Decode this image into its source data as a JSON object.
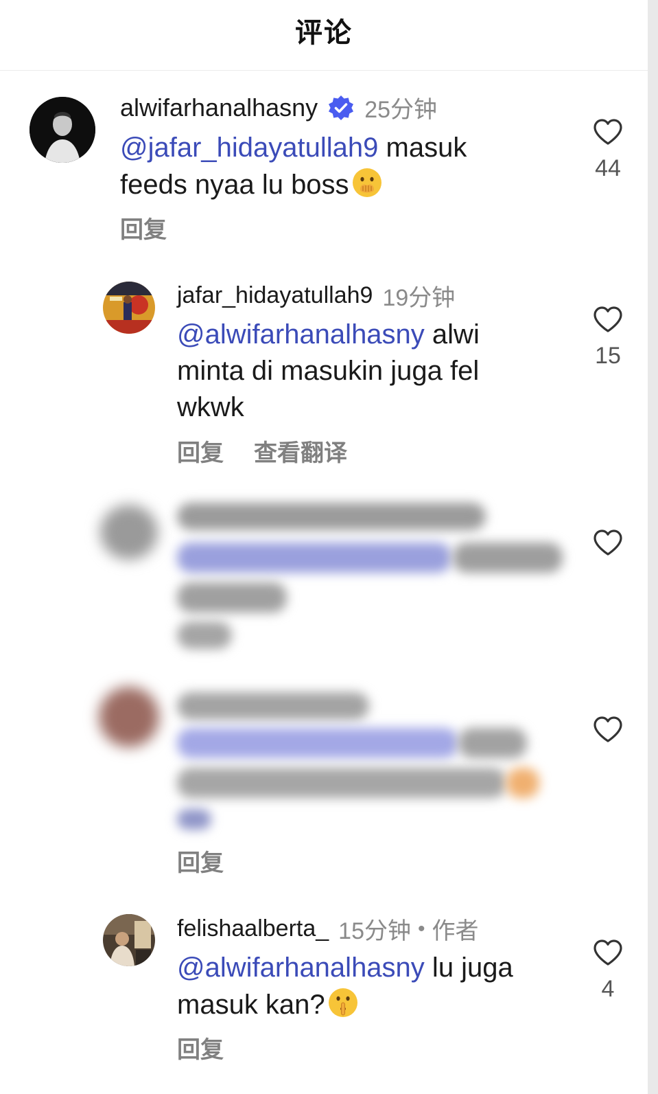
{
  "header": {
    "title": "评论"
  },
  "comments": [
    {
      "username": "alwifarhanalhasny",
      "verified": true,
      "time": "25分钟",
      "mention": "@jafar_hidayatullah9",
      "text_after_mention": " masuk",
      "text_line2": "feeds nyaa lu boss",
      "emoji": "face-with-hand-over-mouth",
      "actions": [
        "回复"
      ],
      "likes": "44"
    },
    {
      "username": "jafar_hidayatullah9",
      "time": "19分钟",
      "mention": "@alwifarhanalhasny",
      "text_after_mention": " alwi",
      "text_line2": "minta di masukin juga fel",
      "text_line3": "wkwk",
      "actions": [
        "回复",
        "查看翻译"
      ],
      "likes": "15"
    },
    {
      "blurred": true
    },
    {
      "blurred": true,
      "actions": [
        "回复"
      ]
    },
    {
      "username": "felishaalberta_",
      "time": "15分钟",
      "author_label": "作者",
      "mention": "@alwifarhanalhasny",
      "text_after_mention": " lu juga",
      "text_line2": "masuk kan?",
      "emoji": "shushing-face",
      "actions": [
        "回复"
      ],
      "likes": "4"
    }
  ],
  "colors": {
    "mention": "#3b4bb8",
    "verified": "#4a5cf0",
    "muted": "#8a8a8a"
  }
}
